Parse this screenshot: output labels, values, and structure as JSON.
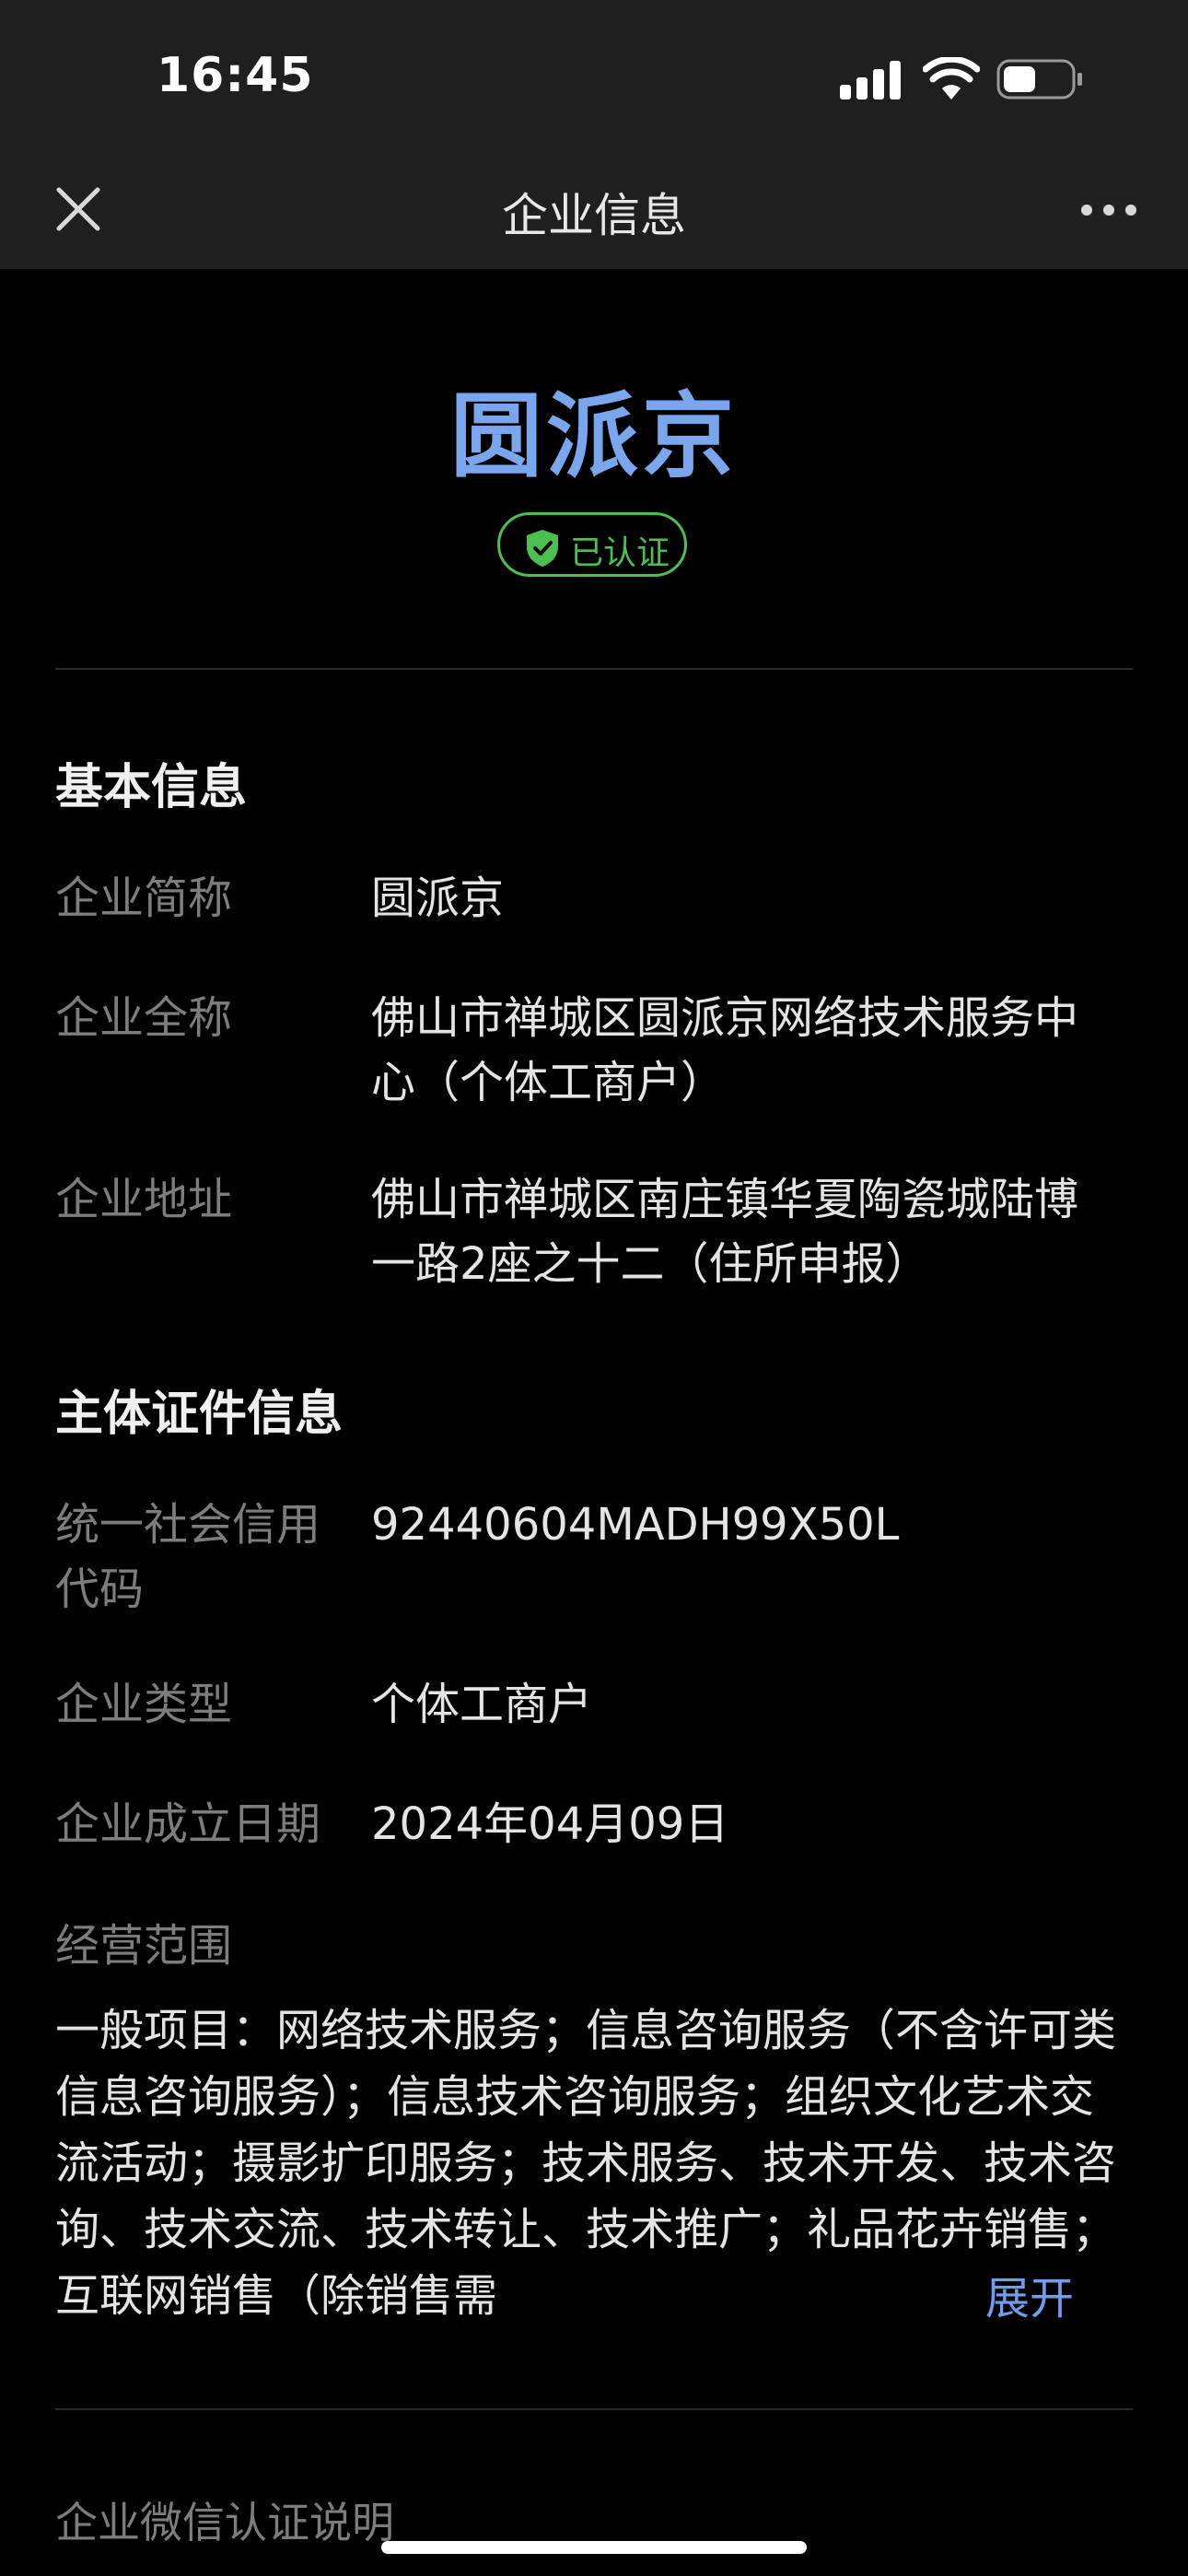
{
  "status_bar": {
    "time": "16:45",
    "icons": [
      "cellular-signal-icon",
      "wifi-icon",
      "battery-icon"
    ]
  },
  "nav": {
    "title": "企业信息",
    "close_icon": "close-icon",
    "more_icon": "more-icon"
  },
  "header": {
    "company_name": "圆派京",
    "verified_label": "已认证",
    "verified_icon": "shield-check-icon"
  },
  "basic_info": {
    "title": "基本信息",
    "rows": [
      {
        "label": "企业简称",
        "value": "圆派京"
      },
      {
        "label": "企业全称",
        "value": "佛山市禅城区圆派京网络技术服务中心（个体工商户）"
      },
      {
        "label": "企业地址",
        "value": "佛山市禅城区南庄镇华夏陶瓷城陆博一路2座之十二（住所申报）"
      }
    ]
  },
  "license_info": {
    "title": "主体证件信息",
    "rows": [
      {
        "label": "统一社会信用代码",
        "value": "92440604MADH99X50L"
      },
      {
        "label": "企业类型",
        "value": "个体工商户"
      },
      {
        "label": "企业成立日期",
        "value": "2024年04月09日"
      }
    ],
    "scope_label": "经营范围",
    "scope_text": "一般项目：网络技术服务；信息咨询服务（不含许可类信息咨询服务）；信息技术咨询服务；组织文化艺术交流活动；摄影扩印服务；技术服务、技术开发、技术咨询、技术交流、技术转让、技术推广；礼品花卉销售；互联网销售（除销售需",
    "expand_label": "展开"
  },
  "footer": {
    "title": "企业微信认证说明"
  },
  "colors": {
    "background": "#000000",
    "bar_background": "#1f1f1f",
    "accent_blue": "#7aa6ee",
    "link_blue": "#6f9ef0",
    "verified_green": "#4cbf52",
    "label_gray": "#7d7d7d"
  }
}
